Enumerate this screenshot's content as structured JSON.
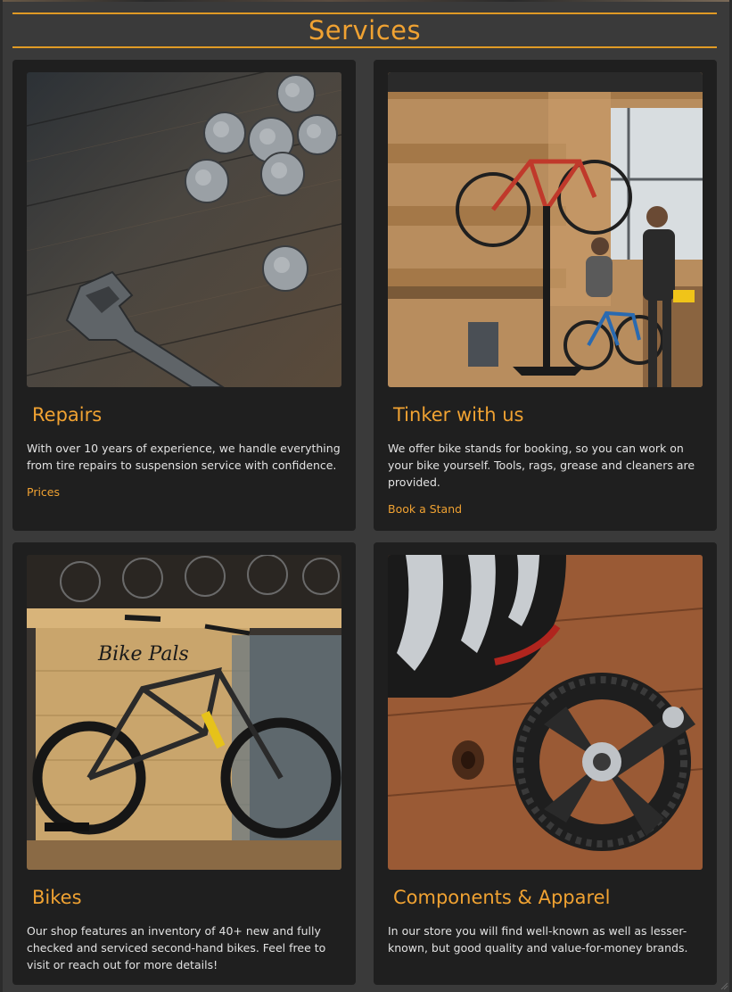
{
  "section": {
    "title": "Services"
  },
  "cards": [
    {
      "title": "Repairs",
      "text": "With over 10 years of experience, we handle everything from tire repairs to suspension service with confidence.",
      "link": "Prices"
    },
    {
      "title": "Tinker with us",
      "text": "We offer bike stands for booking, so you can work on your bike yourself. Tools, rags, grease and cleaners are provided.",
      "link": "Book a Stand"
    },
    {
      "title": "Bikes",
      "text": "Our shop features an inventory of 40+ new and fully checked and serviced second-hand bikes. Feel free to visit or reach out for more details!"
    },
    {
      "title": "Components & Apparel",
      "text": "In our store you will find well-known as well as lesser-known, but good quality and value-for-money brands."
    }
  ],
  "colors": {
    "accent": "#f0a232",
    "background": "#3a3a3a",
    "card": "#1f1f1f"
  }
}
